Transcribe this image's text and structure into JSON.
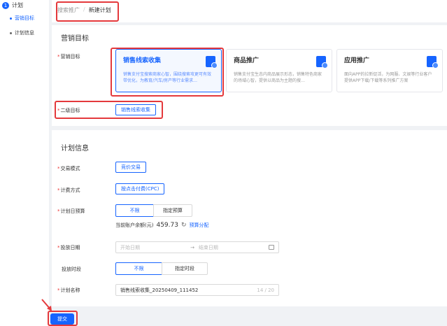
{
  "sidebar": {
    "step_number": "1",
    "step_label": "计划",
    "items": [
      {
        "label": "营销目标",
        "active": true
      },
      {
        "label": "计划信息",
        "active": false
      }
    ]
  },
  "breadcrumb": {
    "parent": "搜索推广",
    "separator": "/",
    "current": "新建计划"
  },
  "marketing": {
    "section_title": "营销目标",
    "goal_label": "营销目标",
    "goals": [
      {
        "title": "销售线索收集",
        "desc": "销售支付宝搜索商家心智，围绕搜索攻更可有效带优化，为教育/汽车/房产等行业需求…",
        "selected": true
      },
      {
        "title": "商品推广",
        "desc": "销售支付宝生态内商品展示形态，销售特色商家的场域心智，提供以商品为主题的搜…",
        "selected": false
      },
      {
        "title": "应用推广",
        "desc": "面向APP的拉新促活，为网服、文娱等行业客户提供APP下载/下载等系列推广方案",
        "selected": false
      }
    ],
    "secondary_label": "二级目标",
    "secondary_value": "销售线索收集"
  },
  "plan": {
    "section_title": "计划信息",
    "trade_mode_label": "交易模式",
    "trade_mode_value": "竞价交易",
    "billing_label": "计费方式",
    "billing_value": "按点击付费(CPC)",
    "budget_label": "计划日预算",
    "budget_options": [
      "不限",
      "指定预算"
    ],
    "balance_label": "当前账户余额(元)",
    "balance_value": "459.73",
    "refresh_icon": "↻",
    "balance_link": "预算分配",
    "date_label": "投放日期",
    "date_start_placeholder": "开始日期",
    "date_arrow": "→",
    "date_end_placeholder": "结束日期",
    "period_label": "投放时段",
    "period_options": [
      "不限",
      "指定时段"
    ],
    "name_label": "计划名称",
    "name_value": "销售线索收集_20250409_111452",
    "name_count": "14 / 20"
  },
  "submit_label": "提交",
  "colors": {
    "accent": "#1664ff",
    "highlight": "#e4393c"
  }
}
